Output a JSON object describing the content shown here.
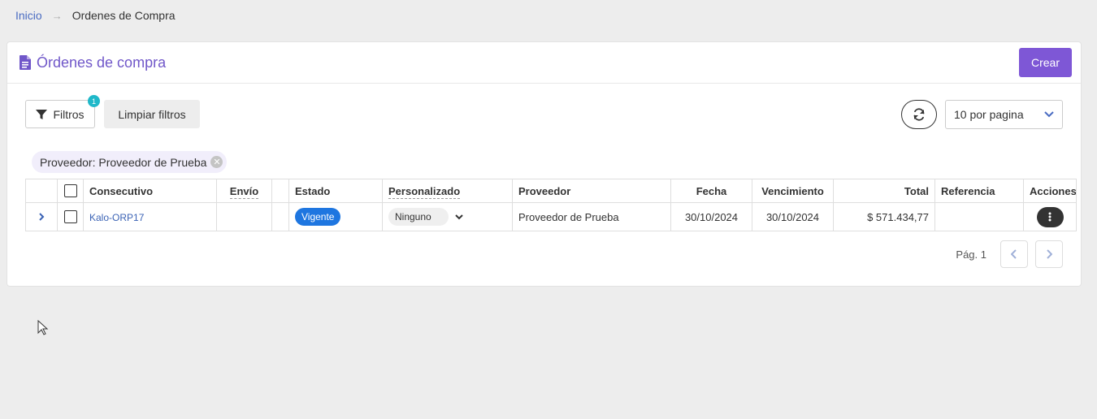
{
  "breadcrumb": {
    "home": "Inicio",
    "separator": "→",
    "current": "Ordenes de Compra"
  },
  "header": {
    "title": "Órdenes de compra",
    "create_label": "Crear"
  },
  "toolbar": {
    "filters_label": "Filtros",
    "filters_count": "1",
    "clear_label": "Limpiar filtros",
    "per_page": "10 por pagina"
  },
  "active_filter": "Proveedor: Proveedor de Prueba",
  "table": {
    "columns": {
      "consecutivo": "Consecutivo",
      "envio": "Envío",
      "estado": "Estado",
      "personalizado": "Personalizado",
      "proveedor": "Proveedor",
      "fecha": "Fecha",
      "vencimiento": "Vencimiento",
      "total": "Total",
      "referencia": "Referencia",
      "acciones": "Acciones"
    },
    "rows": [
      {
        "consecutivo": "Kalo-ORP17",
        "envio": "",
        "estado": "Vigente",
        "personalizado": "Ninguno",
        "proveedor": "Proveedor de Prueba",
        "fecha": "30/10/2024",
        "vencimiento": "30/10/2024",
        "total": "$ 571.434,77",
        "referencia": ""
      }
    ]
  },
  "pagination": {
    "label": "Pág. 1"
  },
  "colors": {
    "accent": "#7e57d6",
    "link": "#3b63b5",
    "status_active": "#1e76e0",
    "badge": "#1fb8c9"
  },
  "icons": [
    "file-text-icon",
    "filter-icon",
    "refresh-icon",
    "chevron-down-icon",
    "chevron-right-icon",
    "chevron-left-icon",
    "close-circle-icon",
    "more-vertical-icon",
    "mouse-cursor-icon"
  ]
}
